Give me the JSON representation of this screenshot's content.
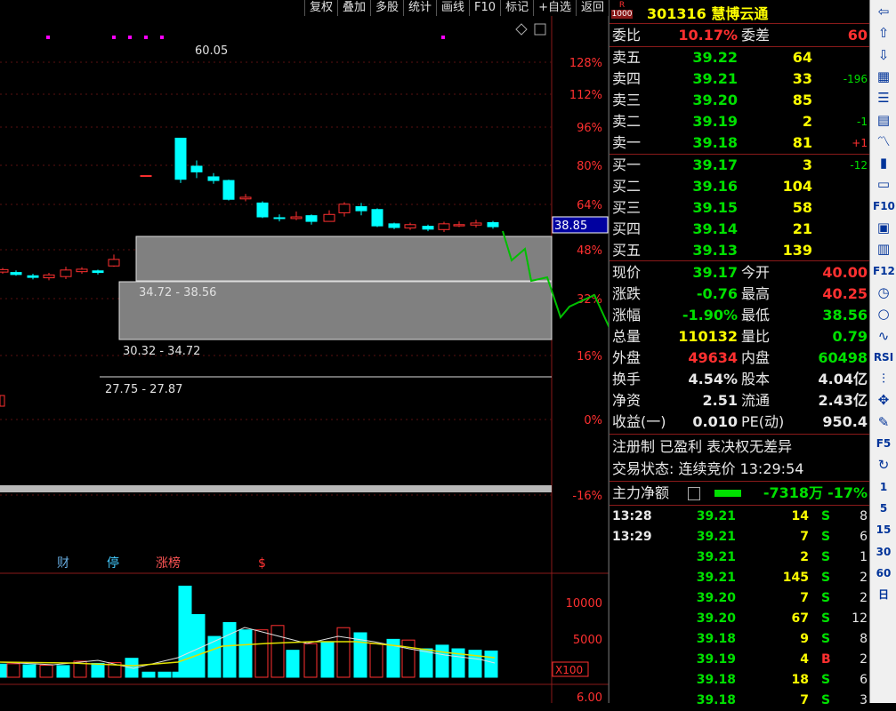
{
  "toolbar": [
    "复权",
    "叠加",
    "多股",
    "统计",
    "画线",
    "F10",
    "标记",
    "+自选",
    "返回"
  ],
  "price_axis": {
    "current_marker": "38.85",
    "labels": [
      "128%",
      "112%",
      "96%",
      "80%",
      "64%",
      "48%",
      "32%",
      "16%",
      "0%",
      "-16%"
    ]
  },
  "chart": {
    "peak_label": "60.05",
    "zones": [
      "34.72 - 38.56",
      "30.32 - 34.72",
      "27.75 - 27.87"
    ],
    "events": [
      "财",
      "停",
      "涨榜",
      "$"
    ],
    "volume_labels": [
      "10000",
      "5000",
      "X100"
    ],
    "bottom_label": "6.00",
    "candles": [
      {
        "o": 27.3,
        "c": 27.9,
        "h": 28.3,
        "l": 26.9
      },
      {
        "o": 27.2,
        "c": 26.7,
        "h": 27.7,
        "l": 26.4
      },
      {
        "o": 26.4,
        "c": 26.0,
        "h": 26.9,
        "l": 25.5
      },
      {
        "o": 25.9,
        "c": 26.6,
        "h": 27.1,
        "l": 25.3
      },
      {
        "o": 26.2,
        "c": 27.8,
        "h": 28.6,
        "l": 25.6
      },
      {
        "o": 27.4,
        "c": 28.0,
        "h": 28.5,
        "l": 26.9
      },
      {
        "o": 27.6,
        "c": 27.2,
        "h": 27.9,
        "l": 26.7
      },
      {
        "o": 28.8,
        "c": 30.4,
        "h": 31.6,
        "l": 28.6
      },
      {
        "o": 50.9,
        "c": 50.9,
        "h": 50.9,
        "l": 50.9
      },
      {
        "o": 60.05,
        "c": 50.0,
        "h": 60.05,
        "l": 49.1
      },
      {
        "o": 53.2,
        "c": 51.8,
        "h": 54.6,
        "l": 50.3
      },
      {
        "o": 50.6,
        "c": 49.7,
        "h": 51.5,
        "l": 48.9
      },
      {
        "o": 49.7,
        "c": 45.1,
        "h": 49.9,
        "l": 44.8
      },
      {
        "o": 45.2,
        "c": 45.6,
        "h": 46.4,
        "l": 44.6
      },
      {
        "o": 44.2,
        "c": 40.8,
        "h": 44.6,
        "l": 40.5
      },
      {
        "o": 40.6,
        "c": 40.4,
        "h": 41.4,
        "l": 39.7
      },
      {
        "o": 40.4,
        "c": 40.8,
        "h": 42.1,
        "l": 40.0
      },
      {
        "o": 41.1,
        "c": 39.7,
        "h": 41.4,
        "l": 38.9
      },
      {
        "o": 39.7,
        "c": 41.4,
        "h": 42.4,
        "l": 39.6
      },
      {
        "o": 41.8,
        "c": 43.9,
        "h": 44.4,
        "l": 40.9
      },
      {
        "o": 43.3,
        "c": 42.3,
        "h": 44.2,
        "l": 41.2
      },
      {
        "o": 42.6,
        "c": 38.6,
        "h": 42.9,
        "l": 38.3
      },
      {
        "o": 39.1,
        "c": 38.2,
        "h": 39.4,
        "l": 37.8
      },
      {
        "o": 38.1,
        "c": 38.9,
        "h": 39.4,
        "l": 37.6
      },
      {
        "o": 38.5,
        "c": 37.8,
        "h": 38.9,
        "l": 37.3
      },
      {
        "o": 37.7,
        "c": 39.1,
        "h": 39.6,
        "l": 37.1
      },
      {
        "o": 38.6,
        "c": 38.9,
        "h": 39.7,
        "l": 38.3
      },
      {
        "o": 38.8,
        "c": 39.3,
        "h": 40.1,
        "l": 38.2
      },
      {
        "o": 39.4,
        "c": 38.4,
        "h": 39.8,
        "l": 37.9
      },
      {
        "o": 38.3,
        "c": 37.2,
        "h": 38.6,
        "l": 36.6
      }
    ],
    "volumes": [
      1800,
      1850,
      1700,
      1650,
      1600,
      2200,
      1900,
      2000,
      2600,
      700,
      700,
      700,
      12500,
      8600,
      5600,
      7500,
      6500,
      6500,
      7100,
      3700,
      4600,
      4800,
      6800,
      6100,
      4600,
      5200,
      5100,
      3900,
      4400,
      3900,
      3700,
      3600,
      3200,
      2900,
      2800,
      2600,
      2000,
      1300
    ]
  },
  "quote": {
    "stock_code": "301316",
    "stock_name": "慧博云通",
    "logo_top": "R",
    "logo_bottom": "1000",
    "weibi_label": "委比",
    "weibi": "10.17%",
    "weicha_label": "委差",
    "weicha": "60",
    "asks": [
      {
        "label": "卖五",
        "price": "39.22",
        "vol": "64",
        "chg": ""
      },
      {
        "label": "卖四",
        "price": "39.21",
        "vol": "33",
        "chg": "-196"
      },
      {
        "label": "卖三",
        "price": "39.20",
        "vol": "85",
        "chg": ""
      },
      {
        "label": "卖二",
        "price": "39.19",
        "vol": "2",
        "chg": "-1"
      },
      {
        "label": "卖一",
        "price": "39.18",
        "vol": "81",
        "chg": "+1"
      }
    ],
    "bids": [
      {
        "label": "买一",
        "price": "39.17",
        "vol": "3",
        "chg": "-12"
      },
      {
        "label": "买二",
        "price": "39.16",
        "vol": "104",
        "chg": ""
      },
      {
        "label": "买三",
        "price": "39.15",
        "vol": "58",
        "chg": ""
      },
      {
        "label": "买四",
        "price": "39.14",
        "vol": "21",
        "chg": ""
      },
      {
        "label": "买五",
        "price": "39.13",
        "vol": "139",
        "chg": ""
      }
    ],
    "stats": [
      {
        "l1": "现价",
        "v1": "39.17",
        "c1": "g",
        "l2": "今开",
        "v2": "40.00",
        "c2": "r"
      },
      {
        "l1": "涨跌",
        "v1": "-0.76",
        "c1": "g",
        "l2": "最高",
        "v2": "40.25",
        "c2": "r"
      },
      {
        "l1": "涨幅",
        "v1": "-1.90%",
        "c1": "g",
        "l2": "最低",
        "v2": "38.56",
        "c2": "g"
      },
      {
        "l1": "总量",
        "v1": "110132",
        "c1": "y",
        "l2": "量比",
        "v2": "0.79",
        "c2": "g"
      },
      {
        "l1": "外盘",
        "v1": "49634",
        "c1": "r",
        "l2": "内盘",
        "v2": "60498",
        "c2": "g"
      },
      {
        "l1": "换手",
        "v1": "4.54%",
        "c1": "w",
        "l2": "股本",
        "v2": "4.04亿",
        "c2": "w"
      },
      {
        "l1": "净资",
        "v1": "2.51",
        "c1": "w",
        "l2": "流通",
        "v2": "2.43亿",
        "c2": "w"
      },
      {
        "l1": "收益(一)",
        "v1": "0.010",
        "c1": "w",
        "l2": "PE(动)",
        "v2": "950.4",
        "c2": "w"
      }
    ],
    "tags": "注册制 已盈利 表决权无差异",
    "trade_status": "交易状态: 连续竞价 13:29:54",
    "main_flow_label": "主力净额",
    "main_flow_value": "-7318万",
    "main_flow_pct": "-17%",
    "ticks": [
      {
        "time": "13:28",
        "price": "39.21",
        "vol": "14",
        "side": "S",
        "n": "8"
      },
      {
        "time": "13:29",
        "price": "39.21",
        "vol": "7",
        "side": "S",
        "n": "6"
      },
      {
        "time": "",
        "price": "39.21",
        "vol": "2",
        "side": "S",
        "n": "1"
      },
      {
        "time": "",
        "price": "39.21",
        "vol": "145",
        "side": "S",
        "n": "2"
      },
      {
        "time": "",
        "price": "39.20",
        "vol": "7",
        "side": "S",
        "n": "2"
      },
      {
        "time": "",
        "price": "39.20",
        "vol": "67",
        "side": "S",
        "n": "12"
      },
      {
        "time": "",
        "price": "39.18",
        "vol": "9",
        "side": "S",
        "n": "8"
      },
      {
        "time": "",
        "price": "39.19",
        "vol": "4",
        "side": "B",
        "n": "2"
      },
      {
        "time": "",
        "price": "39.18",
        "vol": "18",
        "side": "S",
        "n": "6"
      },
      {
        "time": "",
        "price": "39.18",
        "vol": "7",
        "side": "S",
        "n": "3"
      }
    ]
  },
  "sidebar": {
    "items": [
      "back-arrow-icon",
      "up-arrow-icon",
      "down-arrow-icon",
      "chart-icon",
      "list-icon",
      "table-icon",
      "line-chart-icon",
      "candle-icon",
      "news-icon",
      "F10",
      "doc-icon",
      "finance-icon",
      "F12",
      "time-icon",
      "circle-icon",
      "wave-icon",
      "RSI",
      "kline-icon",
      "move-icon",
      "pen-icon",
      "F5",
      "refresh-icon",
      "1",
      "5",
      "15",
      "30",
      "60",
      "日"
    ]
  }
}
